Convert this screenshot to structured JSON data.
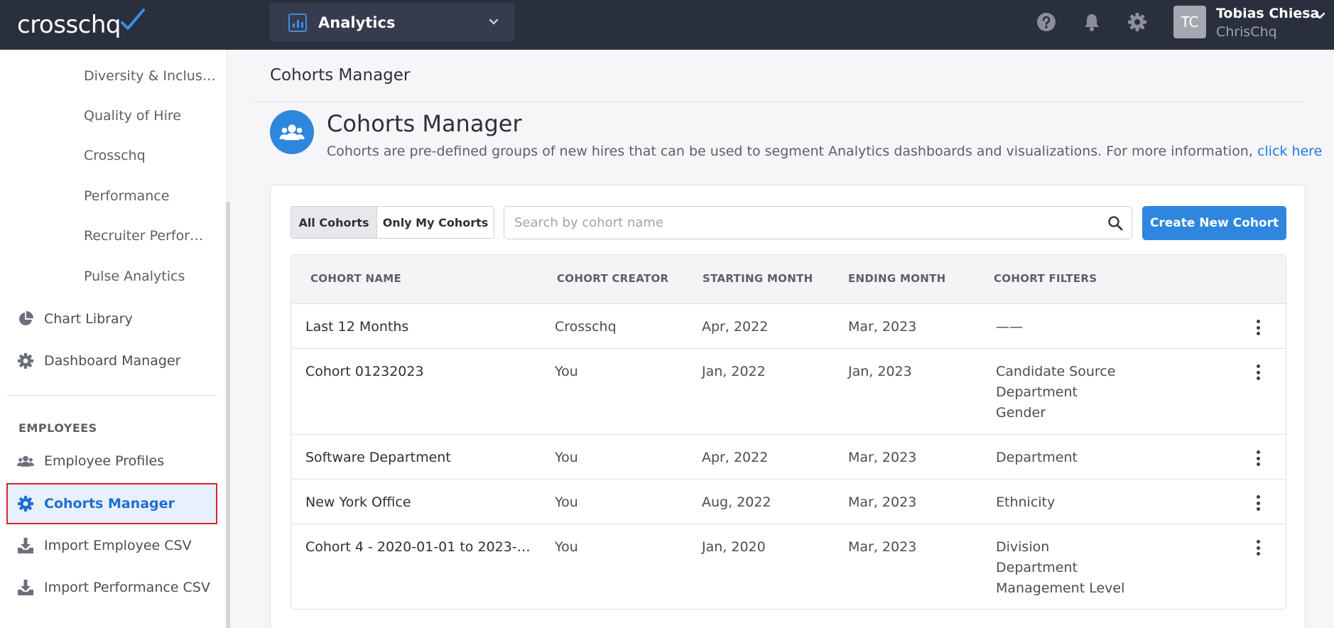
{
  "topbar": {
    "logo": "crosschq",
    "app_switcher": "Analytics",
    "user": {
      "initials": "TC",
      "name": "Tobias Chiesa",
      "org": "ChrisChq"
    }
  },
  "sidebar": {
    "sub_items": [
      "Diversity & Inclus…",
      "Quality of Hire",
      "Crosschq",
      "Performance",
      "Recruiter Perfor…",
      "Pulse Analytics"
    ],
    "chart_library": "Chart Library",
    "dashboard_manager": "Dashboard Manager",
    "section_employees": "EMPLOYEES",
    "employee_profiles": "Employee Profiles",
    "cohorts_manager": "Cohorts Manager",
    "import_employee_csv": "Import Employee CSV",
    "import_performance_csv": "Import Performance CSV"
  },
  "main": {
    "breadcrumb": "Cohorts Manager",
    "title": "Cohorts Manager",
    "description": "Cohorts are pre-defined groups of new hires that can be used to segment Analytics dashboards and visualizations. For more information,",
    "description_link": "click here",
    "filter_all": "All Cohorts",
    "filter_mine": "Only My Cohorts",
    "search_placeholder": "Search by cohort name",
    "create_button": "Create New Cohort",
    "columns": [
      "COHORT NAME",
      "COHORT CREATOR",
      "STARTING MONTH",
      "ENDING MONTH",
      "COHORT FILTERS"
    ],
    "rows": [
      {
        "name": "Last 12 Months",
        "creator": "Crosschq",
        "start": "Apr, 2022",
        "end": "Mar, 2023",
        "filters": [
          "——"
        ]
      },
      {
        "name": "Cohort 01232023",
        "creator": "You",
        "start": "Jan, 2022",
        "end": "Jan, 2023",
        "filters": [
          "Candidate Source",
          "Department",
          "Gender"
        ]
      },
      {
        "name": "Software Department",
        "creator": "You",
        "start": "Apr, 2022",
        "end": "Mar, 2023",
        "filters": [
          "Department"
        ]
      },
      {
        "name": "New York Office",
        "creator": "You",
        "start": "Aug, 2022",
        "end": "Mar, 2023",
        "filters": [
          "Ethnicity"
        ]
      },
      {
        "name": "Cohort 4 - 2020-01-01 to 2023-0…",
        "creator": "You",
        "start": "Jan, 2020",
        "end": "Mar, 2023",
        "filters": [
          "Division",
          "Department",
          "Management Level"
        ]
      }
    ]
  }
}
